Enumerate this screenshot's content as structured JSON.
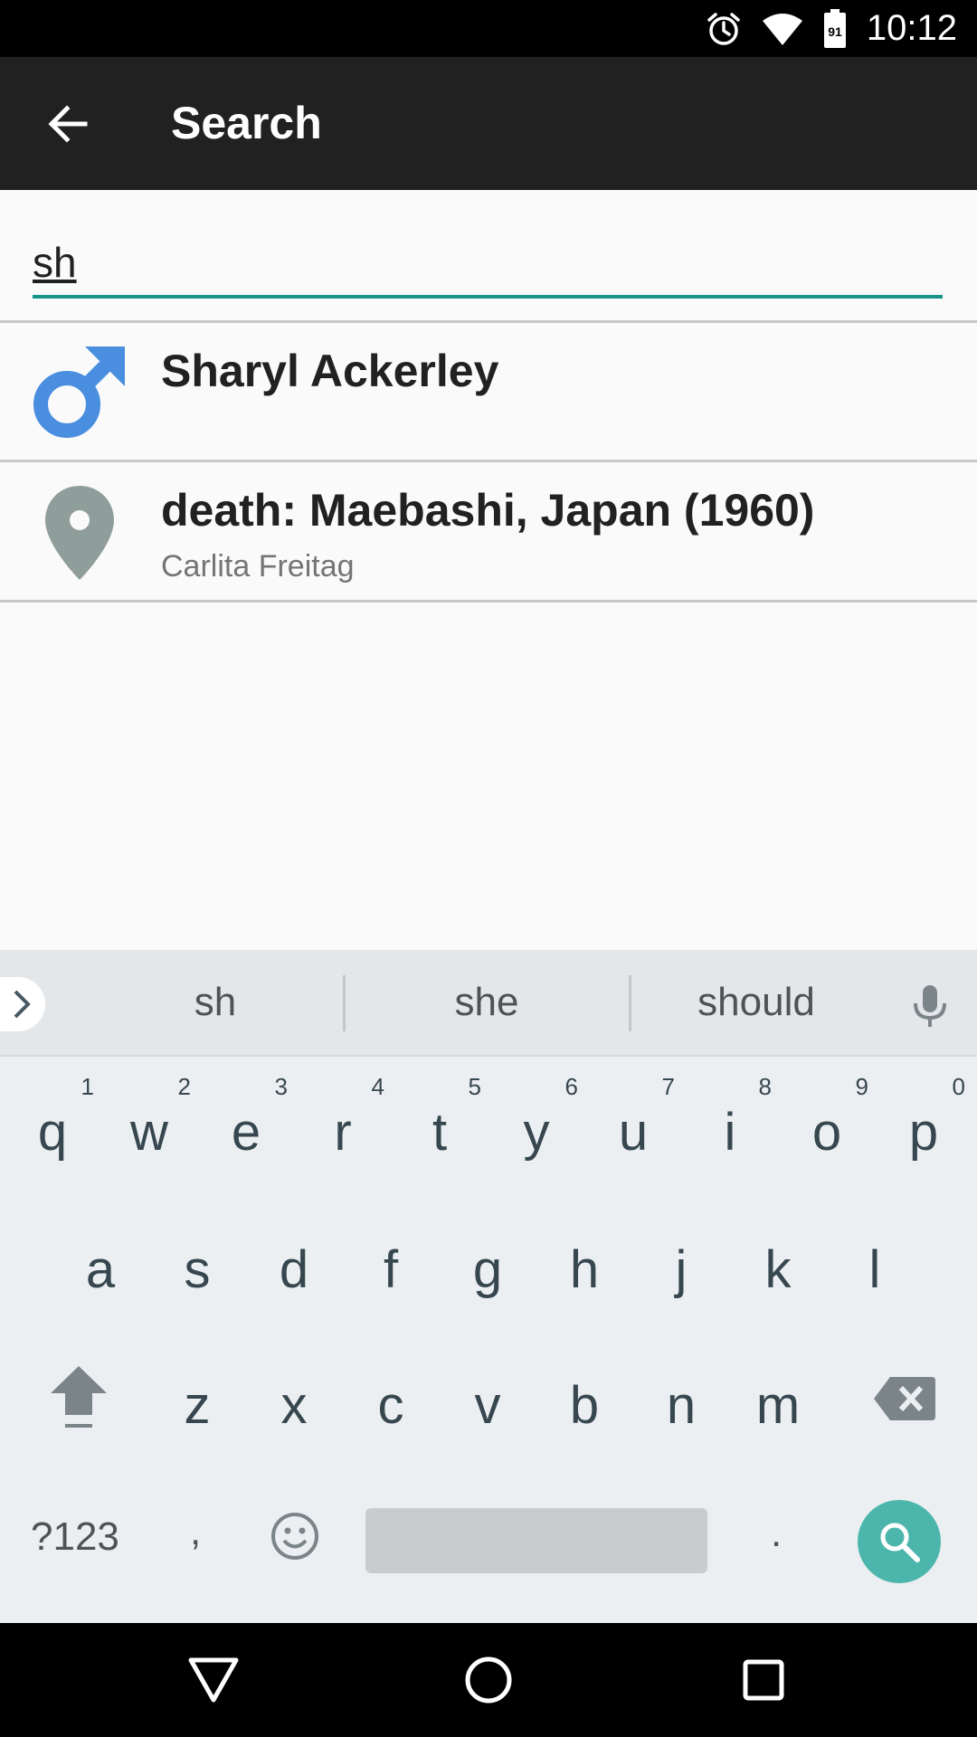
{
  "status_bar": {
    "time": "10:12",
    "battery_level": "91"
  },
  "app_bar": {
    "title": "Search"
  },
  "search": {
    "value": "sh",
    "accent_color": "#16948a"
  },
  "results": [
    {
      "title": "Sharyl Ackerley",
      "subtitle": "",
      "icon": "male-icon",
      "icon_color": "#4a8ee0"
    },
    {
      "title": "death: Maebashi, Japan (1960)",
      "subtitle": "Carlita Freitag",
      "icon": "location-pin-icon",
      "icon_color": "#8f9e9a"
    }
  ],
  "keyboard": {
    "suggestions": [
      "sh",
      "she",
      "should"
    ],
    "row1": [
      {
        "key": "q",
        "hint": "1"
      },
      {
        "key": "w",
        "hint": "2"
      },
      {
        "key": "e",
        "hint": "3"
      },
      {
        "key": "r",
        "hint": "4"
      },
      {
        "key": "t",
        "hint": "5"
      },
      {
        "key": "y",
        "hint": "6"
      },
      {
        "key": "u",
        "hint": "7"
      },
      {
        "key": "i",
        "hint": "8"
      },
      {
        "key": "o",
        "hint": "9"
      },
      {
        "key": "p",
        "hint": "0"
      }
    ],
    "row2": [
      "a",
      "s",
      "d",
      "f",
      "g",
      "h",
      "j",
      "k",
      "l"
    ],
    "row3": [
      "z",
      "x",
      "c",
      "v",
      "b",
      "n",
      "m"
    ],
    "symbols_label": "?123",
    "comma": ",",
    "period": ".",
    "search_key_color": "#4db6ac"
  }
}
